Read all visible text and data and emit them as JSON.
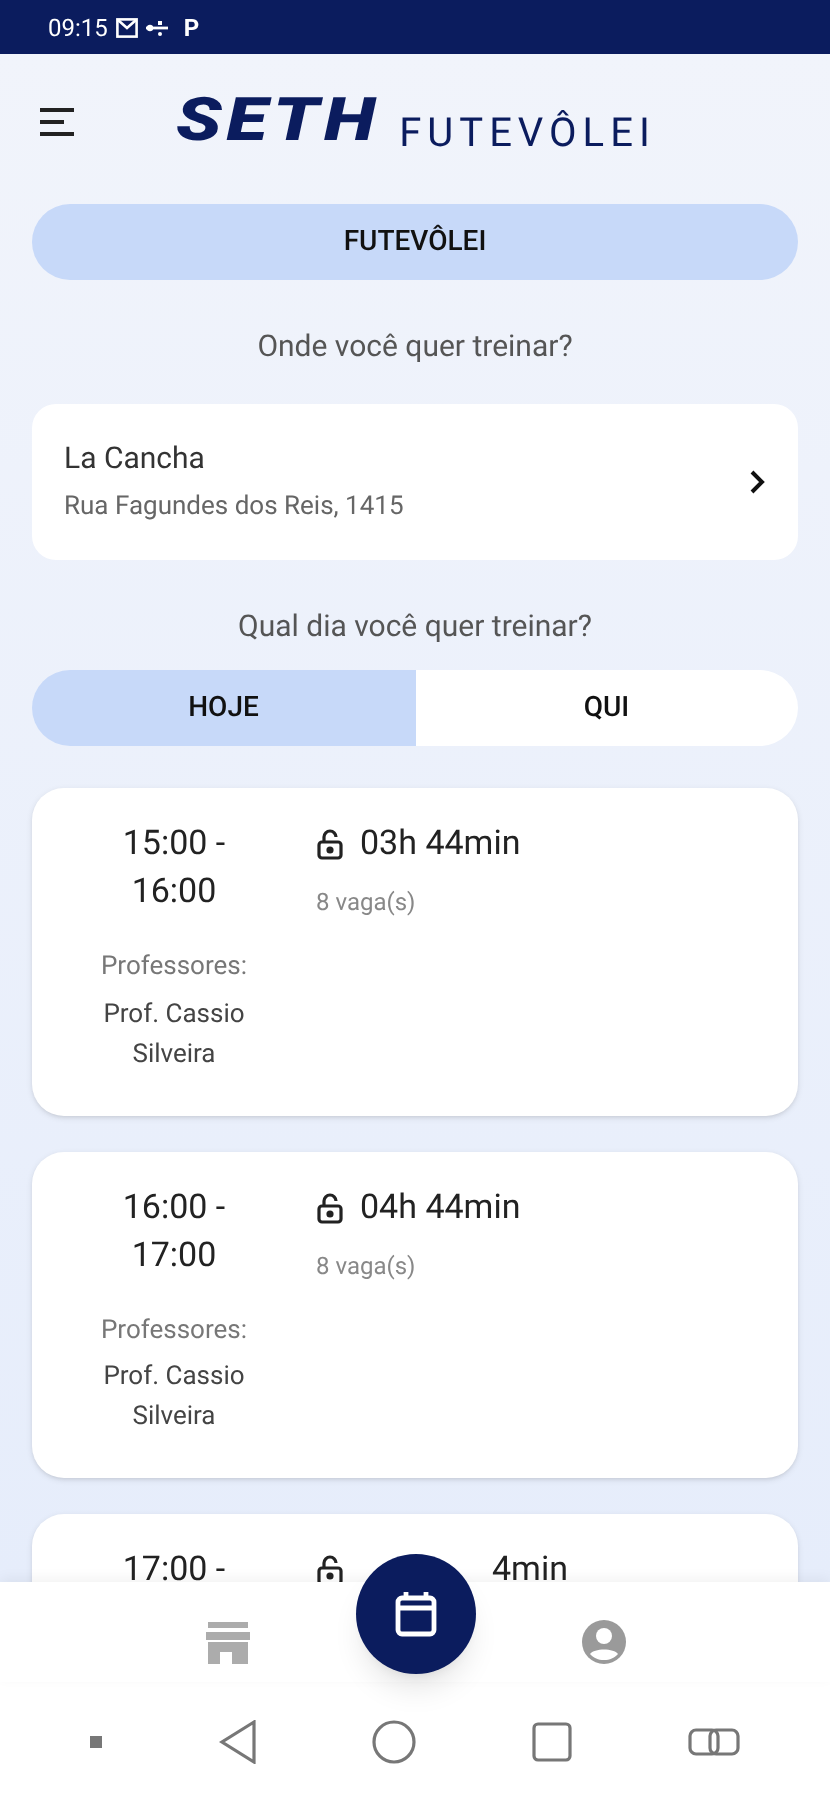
{
  "status_bar": {
    "time": "09:15",
    "app_letter": "P"
  },
  "header": {
    "logo_main": "SETH",
    "logo_sub": "FUTEVÔLEI"
  },
  "sport_button": {
    "label": "FUTEVÔLEI"
  },
  "location_prompt": "Onde você quer treinar?",
  "location": {
    "name": "La Cancha",
    "address": "Rua Fagundes dos Reis, 1415"
  },
  "day_prompt": "Qual dia você quer treinar?",
  "day_tabs": [
    {
      "label": "HOJE",
      "selected": true
    },
    {
      "label": "QUI",
      "selected": false
    }
  ],
  "classes": [
    {
      "time": "15:00 - 16:00",
      "countdown": "03h 44min",
      "spots": "8 vaga(s)",
      "teachers_label": "Professores:",
      "teacher": "Prof. Cassio Silveira"
    },
    {
      "time": "16:00 - 17:00",
      "countdown": "04h 44min",
      "spots": "8 vaga(s)",
      "teachers_label": "Professores:",
      "teacher": "Prof. Cassio Silveira"
    },
    {
      "time": "17:00 -",
      "countdown": "4min",
      "kind": "cut"
    }
  ],
  "bottom_nav": [
    {
      "kind": "store",
      "selected": false
    },
    {
      "kind": "calendar",
      "selected": true
    },
    {
      "kind": "profile",
      "selected": false
    }
  ]
}
